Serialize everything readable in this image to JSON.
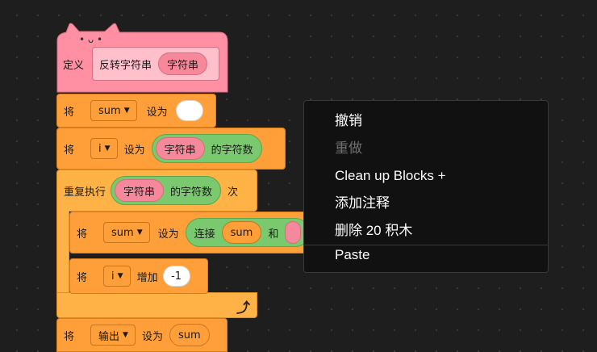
{
  "hat": {
    "face": "• ᴗ •",
    "define": "定义",
    "name": "反转字符串",
    "param": "字符串"
  },
  "set_sum": {
    "verb": "将",
    "var": "sum",
    "to": "设为",
    "value": ""
  },
  "set_i": {
    "verb": "将",
    "var": "i",
    "to": "设为",
    "reporter": "字符串",
    "reporter_suffix": "的字符数"
  },
  "repeat": {
    "label": "重复执行",
    "reporter": "字符串",
    "reporter_suffix": "的字符数",
    "suffix": "次"
  },
  "inner_set_sum": {
    "verb": "将",
    "var": "sum",
    "to": "设为",
    "join": "连接",
    "join_a": "sum",
    "join_and": "和"
  },
  "change_i": {
    "verb": "将",
    "var": "i",
    "by": "增加",
    "value": "-1"
  },
  "set_output": {
    "verb": "将",
    "var": "输出",
    "to": "设为",
    "value": "sum"
  },
  "context_menu": {
    "items": [
      {
        "label": "撤销",
        "enabled": true
      },
      {
        "label": "重做",
        "enabled": false
      },
      {
        "label": "Clean up Blocks +",
        "enabled": true
      },
      {
        "label": "添加注释",
        "enabled": true
      },
      {
        "label": "删除 20 积木",
        "enabled": true
      },
      {
        "label": "Paste",
        "enabled": true
      }
    ]
  },
  "colors": {
    "hat_pink": "#ff8fa3",
    "variables_orange": "#ff9f3a",
    "control_yellow": "#ffb347",
    "operator_green": "#7bc96f",
    "background": "#1e1e1e"
  }
}
